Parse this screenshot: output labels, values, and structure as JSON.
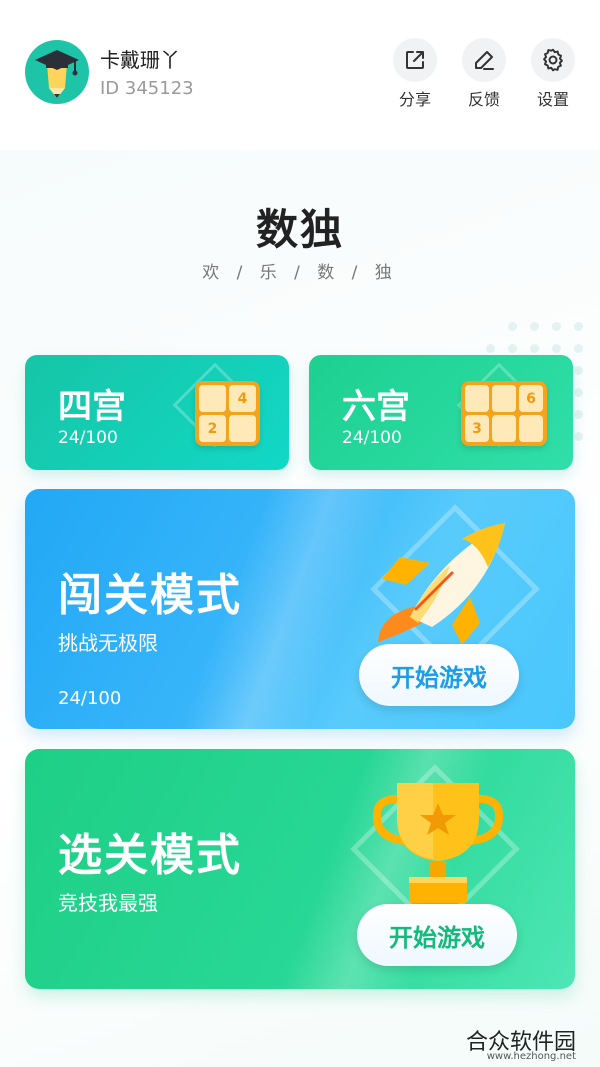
{
  "header": {
    "username": "卡戴珊丫",
    "user_id": "ID 345123",
    "actions": [
      {
        "label": "分享",
        "icon": "share-icon"
      },
      {
        "label": "反馈",
        "icon": "edit-icon"
      },
      {
        "label": "设置",
        "icon": "gear-icon"
      }
    ]
  },
  "title": "数独",
  "subtitle": "欢 / 乐 / 数 / 独",
  "small_cards": {
    "four": {
      "name": "四宫",
      "progress": "24/100",
      "icon": "four-grid-icon",
      "cells": [
        "",
        "4",
        "2",
        ""
      ]
    },
    "six": {
      "name": "六宫",
      "progress": "24/100",
      "icon": "six-grid-icon",
      "cells": [
        "",
        "",
        "6",
        "3",
        "",
        ""
      ]
    }
  },
  "challenge": {
    "name": "闯关模式",
    "desc": "挑战无极限",
    "progress": "24/100",
    "button": "开始游戏",
    "icon": "rocket-icon"
  },
  "select": {
    "name": "选关模式",
    "desc": "竞技我最强",
    "button": "开始游戏",
    "icon": "trophy-icon"
  },
  "watermark": {
    "text": "合众软件园",
    "url": "www.hezhong.net"
  },
  "colors": {
    "teal": "#16c5a6",
    "green": "#1ecf86",
    "blue": "#22a8f5",
    "orange": "#f2a41a"
  }
}
